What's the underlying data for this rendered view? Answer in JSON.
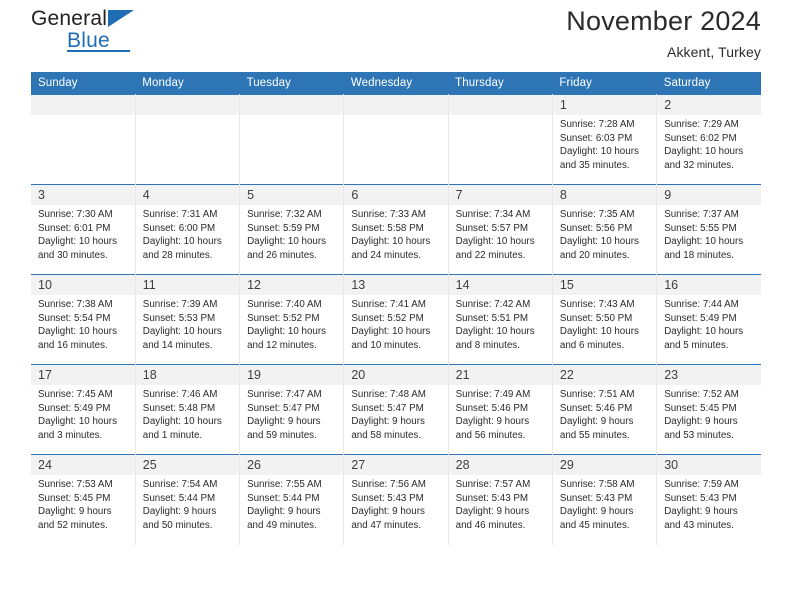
{
  "brand": {
    "name_top": "General",
    "name_bottom": "Blue",
    "accent_color": "#1f6db5",
    "triangle_icon": "brand-triangle-icon"
  },
  "header": {
    "title": "November 2024",
    "subtitle": "Akkent, Turkey"
  },
  "colors": {
    "header_blue": "#2e75b6",
    "daynum_bg": "#f2f2f2",
    "text": "#2b2b2b"
  },
  "calendar": {
    "day_names": [
      "Sunday",
      "Monday",
      "Tuesday",
      "Wednesday",
      "Thursday",
      "Friday",
      "Saturday"
    ],
    "weeks": [
      [
        {
          "day": "",
          "empty": true
        },
        {
          "day": "",
          "empty": true
        },
        {
          "day": "",
          "empty": true
        },
        {
          "day": "",
          "empty": true
        },
        {
          "day": "",
          "empty": true
        },
        {
          "day": "1",
          "sunrise": "Sunrise: 7:28 AM",
          "sunset": "Sunset: 6:03 PM",
          "daylight": "Daylight: 10 hours and 35 minutes."
        },
        {
          "day": "2",
          "sunrise": "Sunrise: 7:29 AM",
          "sunset": "Sunset: 6:02 PM",
          "daylight": "Daylight: 10 hours and 32 minutes."
        }
      ],
      [
        {
          "day": "3",
          "sunrise": "Sunrise: 7:30 AM",
          "sunset": "Sunset: 6:01 PM",
          "daylight": "Daylight: 10 hours and 30 minutes."
        },
        {
          "day": "4",
          "sunrise": "Sunrise: 7:31 AM",
          "sunset": "Sunset: 6:00 PM",
          "daylight": "Daylight: 10 hours and 28 minutes."
        },
        {
          "day": "5",
          "sunrise": "Sunrise: 7:32 AM",
          "sunset": "Sunset: 5:59 PM",
          "daylight": "Daylight: 10 hours and 26 minutes."
        },
        {
          "day": "6",
          "sunrise": "Sunrise: 7:33 AM",
          "sunset": "Sunset: 5:58 PM",
          "daylight": "Daylight: 10 hours and 24 minutes."
        },
        {
          "day": "7",
          "sunrise": "Sunrise: 7:34 AM",
          "sunset": "Sunset: 5:57 PM",
          "daylight": "Daylight: 10 hours and 22 minutes."
        },
        {
          "day": "8",
          "sunrise": "Sunrise: 7:35 AM",
          "sunset": "Sunset: 5:56 PM",
          "daylight": "Daylight: 10 hours and 20 minutes."
        },
        {
          "day": "9",
          "sunrise": "Sunrise: 7:37 AM",
          "sunset": "Sunset: 5:55 PM",
          "daylight": "Daylight: 10 hours and 18 minutes."
        }
      ],
      [
        {
          "day": "10",
          "sunrise": "Sunrise: 7:38 AM",
          "sunset": "Sunset: 5:54 PM",
          "daylight": "Daylight: 10 hours and 16 minutes."
        },
        {
          "day": "11",
          "sunrise": "Sunrise: 7:39 AM",
          "sunset": "Sunset: 5:53 PM",
          "daylight": "Daylight: 10 hours and 14 minutes."
        },
        {
          "day": "12",
          "sunrise": "Sunrise: 7:40 AM",
          "sunset": "Sunset: 5:52 PM",
          "daylight": "Daylight: 10 hours and 12 minutes."
        },
        {
          "day": "13",
          "sunrise": "Sunrise: 7:41 AM",
          "sunset": "Sunset: 5:52 PM",
          "daylight": "Daylight: 10 hours and 10 minutes."
        },
        {
          "day": "14",
          "sunrise": "Sunrise: 7:42 AM",
          "sunset": "Sunset: 5:51 PM",
          "daylight": "Daylight: 10 hours and 8 minutes."
        },
        {
          "day": "15",
          "sunrise": "Sunrise: 7:43 AM",
          "sunset": "Sunset: 5:50 PM",
          "daylight": "Daylight: 10 hours and 6 minutes."
        },
        {
          "day": "16",
          "sunrise": "Sunrise: 7:44 AM",
          "sunset": "Sunset: 5:49 PM",
          "daylight": "Daylight: 10 hours and 5 minutes."
        }
      ],
      [
        {
          "day": "17",
          "sunrise": "Sunrise: 7:45 AM",
          "sunset": "Sunset: 5:49 PM",
          "daylight": "Daylight: 10 hours and 3 minutes."
        },
        {
          "day": "18",
          "sunrise": "Sunrise: 7:46 AM",
          "sunset": "Sunset: 5:48 PM",
          "daylight": "Daylight: 10 hours and 1 minute."
        },
        {
          "day": "19",
          "sunrise": "Sunrise: 7:47 AM",
          "sunset": "Sunset: 5:47 PM",
          "daylight": "Daylight: 9 hours and 59 minutes."
        },
        {
          "day": "20",
          "sunrise": "Sunrise: 7:48 AM",
          "sunset": "Sunset: 5:47 PM",
          "daylight": "Daylight: 9 hours and 58 minutes."
        },
        {
          "day": "21",
          "sunrise": "Sunrise: 7:49 AM",
          "sunset": "Sunset: 5:46 PM",
          "daylight": "Daylight: 9 hours and 56 minutes."
        },
        {
          "day": "22",
          "sunrise": "Sunrise: 7:51 AM",
          "sunset": "Sunset: 5:46 PM",
          "daylight": "Daylight: 9 hours and 55 minutes."
        },
        {
          "day": "23",
          "sunrise": "Sunrise: 7:52 AM",
          "sunset": "Sunset: 5:45 PM",
          "daylight": "Daylight: 9 hours and 53 minutes."
        }
      ],
      [
        {
          "day": "24",
          "sunrise": "Sunrise: 7:53 AM",
          "sunset": "Sunset: 5:45 PM",
          "daylight": "Daylight: 9 hours and 52 minutes."
        },
        {
          "day": "25",
          "sunrise": "Sunrise: 7:54 AM",
          "sunset": "Sunset: 5:44 PM",
          "daylight": "Daylight: 9 hours and 50 minutes."
        },
        {
          "day": "26",
          "sunrise": "Sunrise: 7:55 AM",
          "sunset": "Sunset: 5:44 PM",
          "daylight": "Daylight: 9 hours and 49 minutes."
        },
        {
          "day": "27",
          "sunrise": "Sunrise: 7:56 AM",
          "sunset": "Sunset: 5:43 PM",
          "daylight": "Daylight: 9 hours and 47 minutes."
        },
        {
          "day": "28",
          "sunrise": "Sunrise: 7:57 AM",
          "sunset": "Sunset: 5:43 PM",
          "daylight": "Daylight: 9 hours and 46 minutes."
        },
        {
          "day": "29",
          "sunrise": "Sunrise: 7:58 AM",
          "sunset": "Sunset: 5:43 PM",
          "daylight": "Daylight: 9 hours and 45 minutes."
        },
        {
          "day": "30",
          "sunrise": "Sunrise: 7:59 AM",
          "sunset": "Sunset: 5:43 PM",
          "daylight": "Daylight: 9 hours and 43 minutes."
        }
      ]
    ]
  }
}
